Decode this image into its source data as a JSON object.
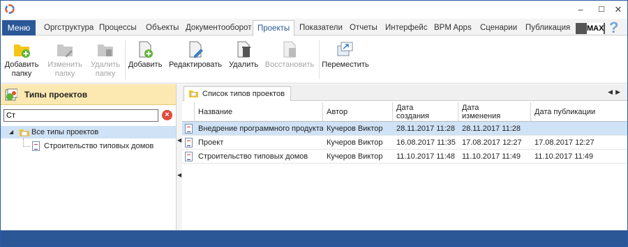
{
  "window": {
    "minimize": "–",
    "maximize": "☐",
    "close": "✕"
  },
  "ribbon": {
    "menu": "Меню",
    "tabs": [
      {
        "label": "Оргструктура"
      },
      {
        "label": "Процессы"
      },
      {
        "label": "Объекты"
      },
      {
        "label": "Документооборот"
      },
      {
        "label": "Проекты"
      },
      {
        "label": "Показатели"
      },
      {
        "label": "Отчеты"
      },
      {
        "label": "Интерфейс"
      },
      {
        "label": "BPM Apps"
      },
      {
        "label": "Сценарии"
      },
      {
        "label": "Публикация"
      }
    ],
    "active_tab": "Проекты",
    "max_label": "MAX",
    "help": "?"
  },
  "toolbar": {
    "add_folder": "Добавить папку",
    "edit_folder": "Изменить папку",
    "delete_folder": "Удалить папку",
    "add": "Добавить",
    "edit": "Редактировать",
    "delete": "Удалить",
    "restore": "Восстановить",
    "move": "Переместить"
  },
  "left_panel": {
    "title": "Типы проектов",
    "search_value": "Ст",
    "tree": {
      "root": "Все типы проектов",
      "children": [
        "Строительство типовых домов"
      ]
    }
  },
  "right_panel": {
    "tab_label": "Список типов проектов",
    "columns": {
      "name": "Название",
      "author": "Автор",
      "created": "Дата создания",
      "modified": "Дата изменения",
      "published": "Дата публикации"
    },
    "rows": [
      {
        "name": "Внедрение программного продукта",
        "author": "Кучеров Виктор",
        "created": "28.11.2017 11:28",
        "modified": "28.11.2017 11:28",
        "published": ""
      },
      {
        "name": "Проект",
        "author": "Кучеров Виктор",
        "created": "16.08.2017 11:35",
        "modified": "17.08.2017 12:27",
        "published": "17.08.2017 12:27"
      },
      {
        "name": "Строительство типовых домов",
        "author": "Кучеров Виктор",
        "created": "11.10.2017 11:48",
        "modified": "11.10.2017 11:49",
        "published": "11.10.2017 11:49"
      }
    ]
  },
  "colors": {
    "accent": "#2b5797",
    "selection": "#cfe2f6",
    "panel_header": "#fbe9b1"
  }
}
